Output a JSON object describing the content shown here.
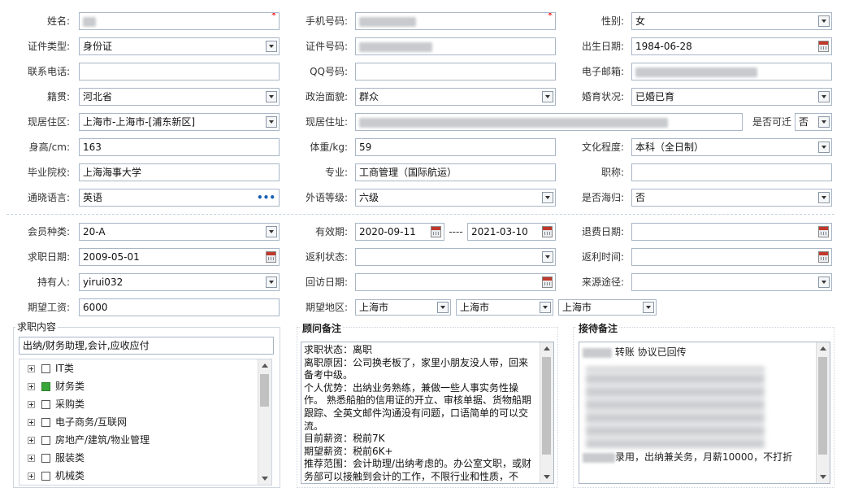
{
  "basic": {
    "name_label": "姓名:",
    "phone_label": "手机号码:",
    "gender_label": "性别:",
    "gender_value": "女",
    "id_type_label": "证件类型:",
    "id_type_value": "身份证",
    "id_no_label": "证件号码:",
    "birth_label": "出生日期:",
    "birth_value": "1984-06-28",
    "tel_label": "联系电话:",
    "qq_label": "QQ号码:",
    "email_label": "电子邮箱:",
    "origin_label": "籍贯:",
    "origin_value": "河北省",
    "political_label": "政治面貌:",
    "political_value": "群众",
    "marital_label": "婚育状况:",
    "marital_value": "已婚已育",
    "residence_label": "现居住区:",
    "residence_value": "上海市-上海市-[浦东新区]",
    "address_label": "现居住址:",
    "relocate_label": "是否可迁",
    "relocate_value": "否",
    "height_label": "身高/cm:",
    "height_value": "163",
    "weight_label": "体重/kg:",
    "weight_value": "59",
    "edu_label": "文化程度:",
    "edu_value": "本科（全日制）",
    "school_label": "毕业院校:",
    "school_value": "上海海事大学",
    "major_label": "专业:",
    "major_value": "工商管理（国际航运）",
    "title_label": "职称:",
    "lang_label": "通晓语言:",
    "lang_value": "英语",
    "lang_dots": "•••",
    "lang_level_label": "外语等级:",
    "lang_level_value": "六级",
    "overseas_label": "是否海归:",
    "overseas_value": "否"
  },
  "member": {
    "type_label": "会员种类:",
    "type_value": "20-A",
    "valid_label": "有效期:",
    "valid_from": "2020-09-11",
    "valid_sep": "----",
    "valid_to": "2021-03-10",
    "refund_label": "退费日期:",
    "job_date_label": "求职日期:",
    "job_date_value": "2009-05-01",
    "rebate_status_label": "返利状态:",
    "rebate_time_label": "返利时间:",
    "holder_label": "持有人:",
    "holder_value": "yirui032",
    "visit_label": "回访日期:",
    "source_label": "来源途径:",
    "salary_label": "期望工资:",
    "salary_value": "6000",
    "region_label": "期望地区:",
    "region1": "上海市",
    "region2": "上海市",
    "region3": "上海市"
  },
  "job_panel": {
    "title": "求职内容",
    "summary": "出纳/财务助理,会计,应收应付",
    "items": [
      {
        "label": "IT类"
      },
      {
        "label": "财务类"
      },
      {
        "label": "采购类"
      },
      {
        "label": "电子商务/互联网"
      },
      {
        "label": "房地产/建筑/物业管理"
      },
      {
        "label": "服装类"
      },
      {
        "label": "机械类"
      }
    ]
  },
  "advisor_panel": {
    "title": "顾问备注",
    "text": "求职状态：离职\n离职原因：公司换老板了，家里小朋友没人带，回来备考中级。\n个人优势：出纳业务熟练，兼做一些人事实务性操作。 熟悉船舶的信用证的开立、审核单据、货物船期跟踪、全英文邮件沟通没有问题，口语简单的可以交流。\n目前薪资：税前7K\n期望薪资：税前6K+\n推荐范围：会计助理/出纳考虑的。办公室文职，或财务部可以接触到会计的工作，不限行业和性质，不"
  },
  "reception_panel": {
    "title": "接待备注",
    "line1": "转账 协议已回传",
    "line2": "录用，出纳兼关务，月薪10000，不打折"
  }
}
